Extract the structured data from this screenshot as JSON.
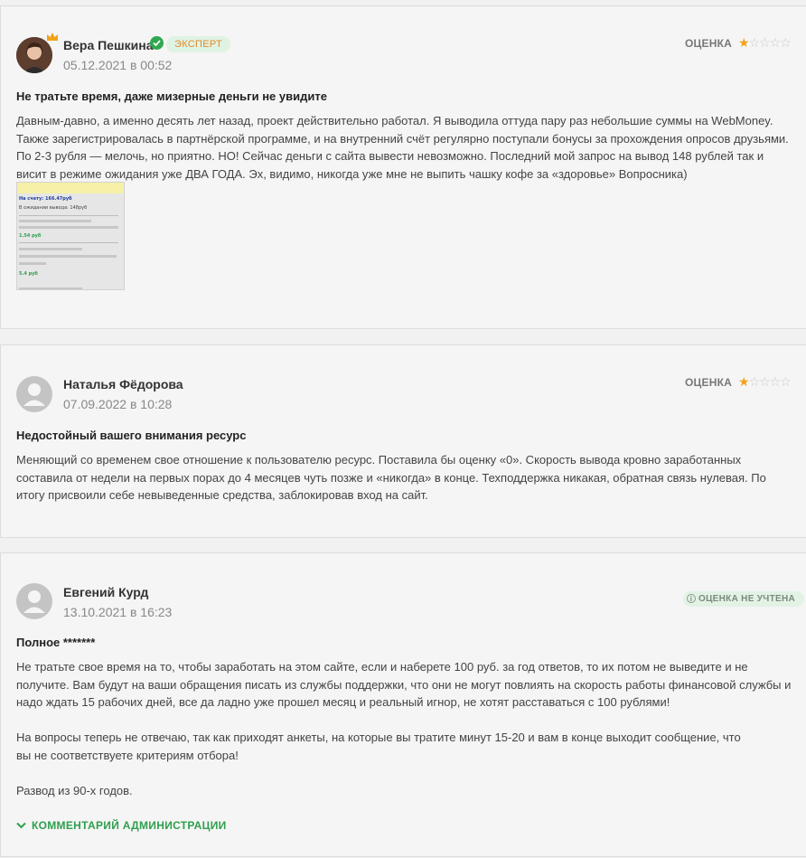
{
  "reviews": [
    {
      "author": "Вера Пешкина",
      "badge": "ЭКСПЕРТ",
      "date": "05.12.2021 в 00:52",
      "rating_label": "ОЦЕНКА",
      "rating": 1,
      "rating_max": 5,
      "title": "Не тратьте время, даже мизерные деньги не увидите",
      "paragraphs": [
        "Давным-давно, а именно десять лет назад, проект действительно работал. Я выводила оттуда пару раз небольшие суммы на WebMoney. Также зарегистрировалась в партнёрской программе, и на внутренний счёт регулярно поступали бонусы за прохождения опросов друзьями. По 2-3 рубля — мелочь, но приятно. НО! Сейчас деньги с сайта вывести невозможно. Последний мой запрос на вывод 148 рублей так и висит в режиме ожидания уже ДВА ГОДА. Эх, видимо, никогда уже мне не выпить чашку кофе за «здоровье» Вопросника)"
      ],
      "attachment": {
        "line1": "На счету: 166.47руб",
        "line2": "В ожидании вывода: 148руб",
        "amount1": "1.54 руб",
        "amount2": "5.4 руб"
      }
    },
    {
      "author": "Наталья Фёдорова",
      "date": "07.09.2022 в 10:28",
      "rating_label": "ОЦЕНКА",
      "rating": 1,
      "rating_max": 5,
      "title": "Недостойный вашего внимания ресурс",
      "paragraphs": [
        "Меняющий со временем свое отношение к пользователю ресурс. Поставила бы оценку «0». Скорость вывода кровно заработанных составила от недели на первых порах до 4 месяцев чуть позже и «никогда» в конце. Техподдержка никакая, обратная связь нулевая. По итогу присвоили себе невыведенные средства, заблокировав вход на сайт."
      ]
    },
    {
      "author": "Евгений Курд",
      "date": "13.10.2021 в 16:23",
      "status": "ОЦЕНКА НЕ УЧТЕНА",
      "title": "Полное *******",
      "paragraphs": [
        "Не тратьте свое время на то, чтобы заработать на этом сайте, если и наберете 100 руб. за год ответов, то их потом не выведите и не получите. Вам будут на ваши обращения писать из службы поддержки, что они не могут повлиять на скорость работы финансовой службы и надо ждать 15 рабочих дней, все да ладно уже прошел месяц и реальный игнор, не хотят расставаться с 100 рублями!",
        "На вопросы теперь не отвечаю, так как приходят анкеты, на которые вы тратите минут 15-20 и вам в конце выходит сообщение, что\nвы не соответствуете критериям отбора!",
        "Развод из 90-х годов."
      ],
      "admin_comment_label": "КОММЕНТАРИЙ АДМИНИСТРАЦИИ"
    }
  ],
  "colors": {
    "accent_green": "#2e9f4d",
    "star_active": "#f2a118",
    "star_inactive": "#c9c9c9",
    "expert_badge_text": "#e28a2c"
  }
}
